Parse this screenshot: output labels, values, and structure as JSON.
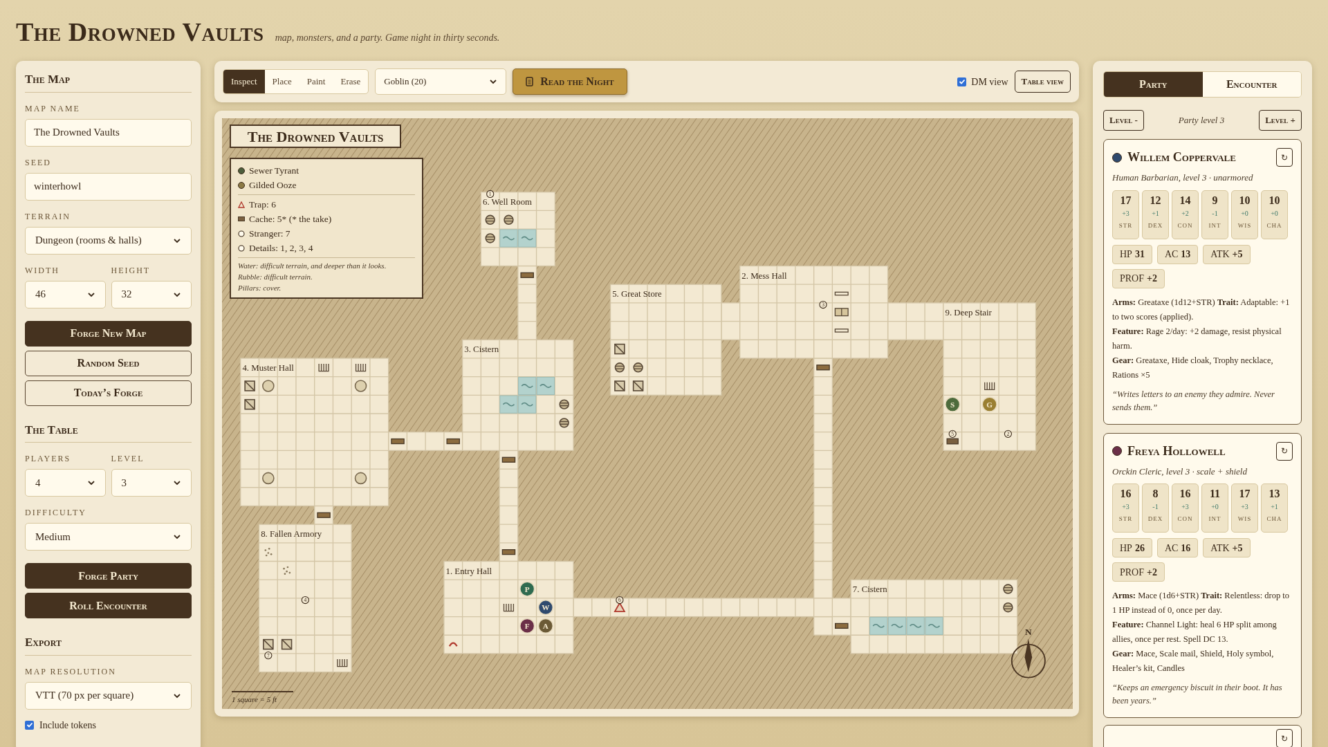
{
  "header": {
    "title": "The Drowned Vaults",
    "tagline": "map, monsters, and a party. Game night in thirty seconds."
  },
  "sidebar": {
    "sections": [
      {
        "title": "The Map",
        "controls": [
          {
            "kind": "input",
            "label": "MAP NAME",
            "value": "The Drowned Vaults"
          },
          {
            "kind": "input",
            "label": "SEED",
            "value": "winterhowl"
          },
          {
            "kind": "select",
            "label": "TERRAIN",
            "value": "Dungeon (rooms & halls)"
          },
          {
            "kind": "pair",
            "items": [
              {
                "label": "WIDTH",
                "value": "46"
              },
              {
                "label": "HEIGHT",
                "value": "32"
              }
            ]
          },
          {
            "kind": "button",
            "label": "Forge New Map",
            "primary": true
          },
          {
            "kind": "button",
            "label": "Random Seed",
            "primary": false
          },
          {
            "kind": "button",
            "label": "Today’s Forge",
            "primary": false
          }
        ]
      },
      {
        "title": "The Table",
        "controls": [
          {
            "kind": "pair",
            "items": [
              {
                "label": "PLAYERS",
                "value": "4"
              },
              {
                "label": "LEVEL",
                "value": "3"
              }
            ]
          },
          {
            "kind": "select",
            "label": "DIFFICULTY",
            "value": "Medium"
          },
          {
            "kind": "button",
            "label": "Forge Party",
            "primary": true
          },
          {
            "kind": "button",
            "label": "Roll Encounter",
            "primary": true
          }
        ]
      },
      {
        "title": "Export",
        "controls": [
          {
            "kind": "select",
            "label": "MAP RESOLUTION",
            "value": "VTT (70 px per square)"
          },
          {
            "kind": "checkbox",
            "label": "Include tokens",
            "checked": true
          }
        ]
      }
    ]
  },
  "toolbar": {
    "tools": [
      {
        "label": "Inspect",
        "selected": true
      },
      {
        "label": "Place",
        "selected": false
      },
      {
        "label": "Paint",
        "selected": false
      },
      {
        "label": "Erase",
        "selected": false
      }
    ],
    "monster_select": "Goblin (20)",
    "read_button": "Read the Night",
    "dm_view": {
      "label": "DM view",
      "checked": true
    },
    "table_view_button": "Table view"
  },
  "map": {
    "title": "The Drowned Vaults",
    "legend": {
      "monsters": [
        {
          "label": "Sewer Tyrant",
          "color": "#4d5e3c"
        },
        {
          "label": "Gilded Ooze",
          "color": "#8c7a45"
        }
      ],
      "keys": [
        {
          "kind": "trap",
          "label": "Trap: 6"
        },
        {
          "kind": "cache",
          "label": "Cache: 5* (* the take)"
        },
        {
          "kind": "ring",
          "label": "Stranger: 7"
        },
        {
          "kind": "ring",
          "label": "Details: 1, 2, 3, 4"
        }
      ],
      "notes": [
        "Water: difficult terrain, and deeper than it looks.",
        "Rubble: difficult terrain.",
        "Pillars: cover."
      ]
    },
    "rooms": [
      {
        "label": "6. Well Room"
      },
      {
        "label": "5. Great Store"
      },
      {
        "label": "2. Mess Hall"
      },
      {
        "label": "9. Deep Stair"
      },
      {
        "label": "3. Cistern"
      },
      {
        "label": "4. Muster Hall"
      },
      {
        "label": "8. Fallen Armory"
      },
      {
        "label": "1. Entry Hall"
      },
      {
        "label": "7. Cistern"
      }
    ],
    "tokens": [
      {
        "label": "S",
        "color": "#4d6b3c"
      },
      {
        "label": "G",
        "color": "#9a7f32"
      },
      {
        "label": "P",
        "color": "#2f6b50"
      },
      {
        "label": "W",
        "color": "#2f4a6e"
      },
      {
        "label": "F",
        "color": "#6b2f48"
      },
      {
        "label": "A",
        "color": "#6b5a36"
      }
    ],
    "markers": [
      {
        "label": "1"
      },
      {
        "label": "3"
      },
      {
        "label": "5"
      },
      {
        "label": "2"
      },
      {
        "label": "4"
      },
      {
        "label": "6"
      },
      {
        "label": "7"
      }
    ],
    "compass": "N",
    "scale": "1 square = 5 ft"
  },
  "party_panel": {
    "tabs": [
      {
        "label": "Party",
        "selected": true
      },
      {
        "label": "Encounter",
        "selected": false
      }
    ],
    "level_down": "Level -",
    "level_text": "Party level 3",
    "level_up": "Level +",
    "characters": [
      {
        "name": "Willem Coppervale",
        "color": "#2f4a6e",
        "reroll": "↻",
        "subtitle": "Human Barbarian, level 3 · unarmored",
        "stats": [
          {
            "value": "17",
            "mod": "+3",
            "label": "STR"
          },
          {
            "value": "12",
            "mod": "+1",
            "label": "DEX"
          },
          {
            "value": "14",
            "mod": "+2",
            "label": "CON"
          },
          {
            "value": "9",
            "mod": "-1",
            "label": "INT"
          },
          {
            "value": "10",
            "mod": "+0",
            "label": "WIS"
          },
          {
            "value": "10",
            "mod": "+0",
            "label": "CHA"
          }
        ],
        "chips": [
          {
            "label": "HP",
            "value": "31"
          },
          {
            "label": "AC",
            "value": "13"
          },
          {
            "label": "ATK",
            "value": "+5"
          },
          {
            "label": "PROF",
            "value": "+2"
          }
        ],
        "details": [
          "**Arms:** Greataxe (1d12+STR)   **Trait:** Adaptable: +1 to two scores (applied).",
          "**Feature:** Rage 2/day: +2 damage, resist physical harm.",
          "**Gear:** Greataxe, Hide cloak, Trophy necklace, Rations ×5"
        ],
        "quote": "“Writes letters to an enemy they admire. Never sends them.”"
      },
      {
        "name": "Freya Hollowell",
        "color": "#6b2f48",
        "reroll": "↻",
        "subtitle": "Orckin Cleric, level 3 · scale + shield",
        "stats": [
          {
            "value": "16",
            "mod": "+3",
            "label": "STR"
          },
          {
            "value": "8",
            "mod": "-1",
            "label": "DEX"
          },
          {
            "value": "16",
            "mod": "+3",
            "label": "CON"
          },
          {
            "value": "11",
            "mod": "+0",
            "label": "INT"
          },
          {
            "value": "17",
            "mod": "+3",
            "label": "WIS"
          },
          {
            "value": "13",
            "mod": "+1",
            "label": "CHA"
          }
        ],
        "chips": [
          {
            "label": "HP",
            "value": "26"
          },
          {
            "label": "AC",
            "value": "16"
          },
          {
            "label": "ATK",
            "value": "+5"
          },
          {
            "label": "PROF",
            "value": "+2"
          }
        ],
        "details": [
          "**Arms:** Mace (1d6+STR)   **Trait:** Relentless: drop to 1 HP instead of 0, once per day.",
          "**Feature:** Channel Light: heal 6 HP split among allies, once per rest. Spell DC 13.",
          "**Gear:** Mace, Scale mail, Shield, Holy symbol, Healer’s kit, Candles"
        ],
        "quote": "“Keeps an emergency biscuit in their boot. It has been years.”"
      }
    ],
    "next_card_reroll": "↻"
  }
}
